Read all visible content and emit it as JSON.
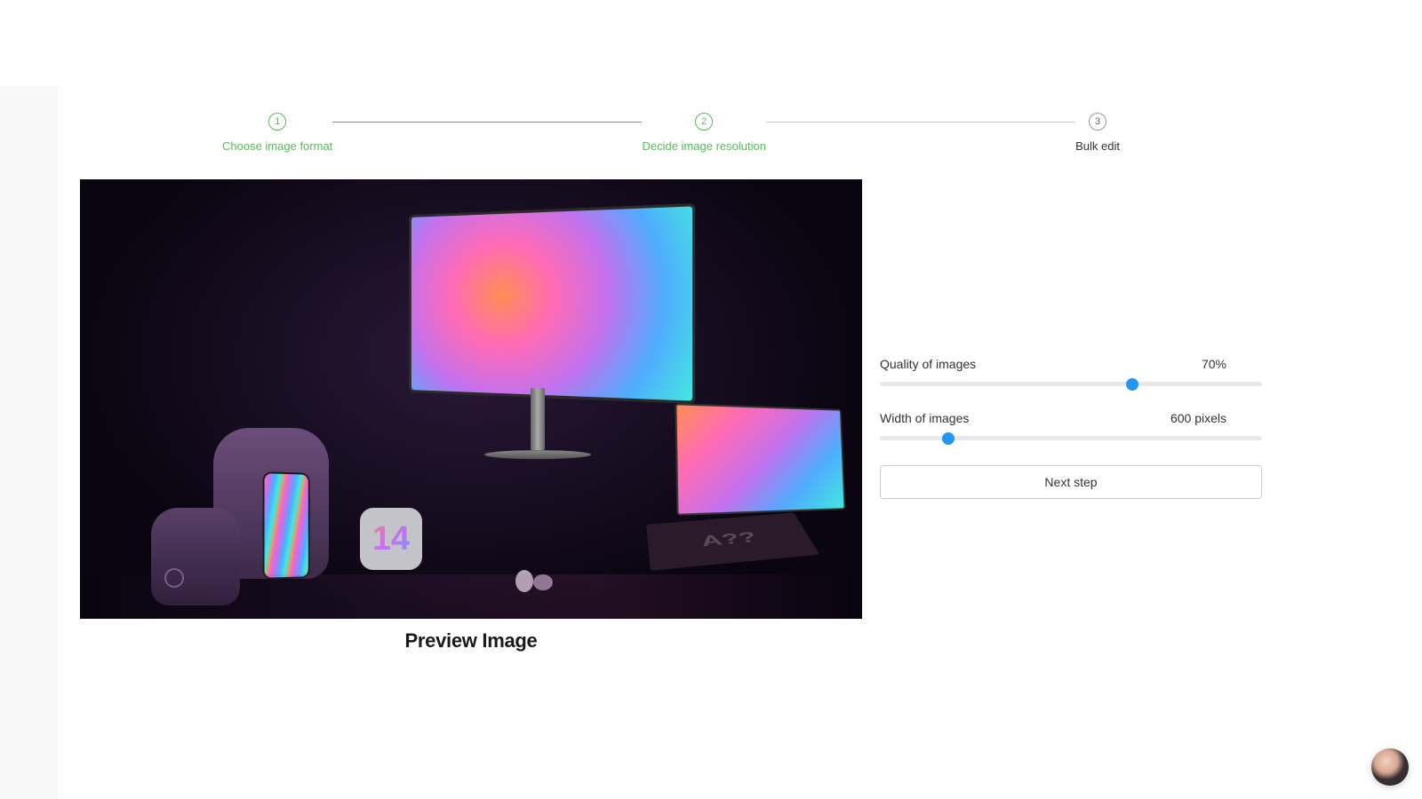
{
  "stepper": {
    "steps": [
      {
        "number": "1",
        "label": "Choose image format",
        "active": true
      },
      {
        "number": "2",
        "label": "Decide image resolution",
        "active": true
      },
      {
        "number": "3",
        "label": "Bulk edit",
        "active": false
      }
    ]
  },
  "preview": {
    "caption": "Preview Image",
    "laptop_logo_text": "A??",
    "ios_tile_text": "14"
  },
  "controls": {
    "quality": {
      "label": "Quality of images",
      "value_display": "70%",
      "value_percent": 66
    },
    "width": {
      "label": "Width of images",
      "value_display": "600 pixels",
      "value_percent": 18
    },
    "next_button_label": "Next step"
  },
  "colors": {
    "accent_green": "#5cb85c",
    "slider_blue": "#2196f3"
  }
}
